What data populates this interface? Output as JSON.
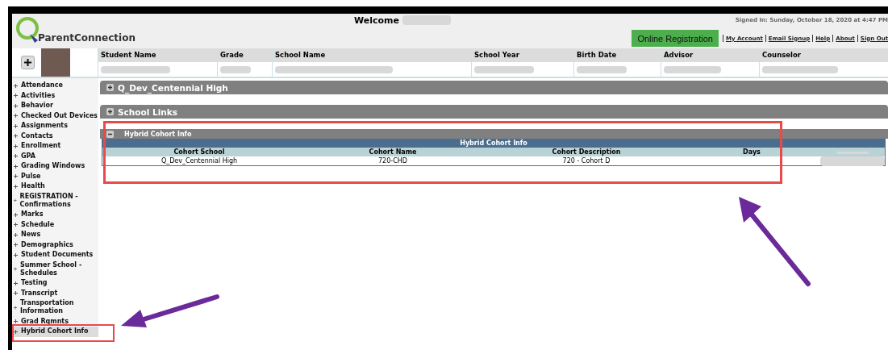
{
  "header": {
    "welcome": "Welcome",
    "signed_in": "Signed In: Sunday, October 18, 2020 at 4:47 PM",
    "logo": "ParentConnection",
    "registration_button": "Online Registration",
    "links": [
      "My Account",
      "Email Signup",
      "Help",
      "About",
      "Sign Out"
    ]
  },
  "student_table": {
    "columns": [
      "Student Name",
      "Grade",
      "School Name",
      "School Year",
      "Birth Date",
      "Advisor",
      "Counselor"
    ]
  },
  "sidebar": {
    "items": [
      {
        "label": "Attendance",
        "selected": false
      },
      {
        "label": "Activities",
        "selected": false
      },
      {
        "label": "Behavior",
        "selected": false
      },
      {
        "label": "Checked Out Devices",
        "selected": false
      },
      {
        "label": "Assignments",
        "selected": false
      },
      {
        "label": "Contacts",
        "selected": false
      },
      {
        "label": "Enrollment",
        "selected": false
      },
      {
        "label": "GPA",
        "selected": false
      },
      {
        "label": "Grading Windows",
        "selected": false
      },
      {
        "label": "Pulse",
        "selected": false
      },
      {
        "label": "Health",
        "selected": false
      },
      {
        "label": "REGISTRATION - Confirmations",
        "selected": false
      },
      {
        "label": "Marks",
        "selected": false
      },
      {
        "label": "Schedule",
        "selected": false
      },
      {
        "label": "News",
        "selected": false
      },
      {
        "label": "Demographics",
        "selected": false
      },
      {
        "label": "Student Documents",
        "selected": false
      },
      {
        "label": "Summer School - Schedules",
        "selected": false
      },
      {
        "label": "Testing",
        "selected": false
      },
      {
        "label": "Transcript",
        "selected": false
      },
      {
        "label": "Transportation Information",
        "selected": false
      },
      {
        "label": "Grad Rqmnts",
        "selected": false
      },
      {
        "label": "Hybrid Cohort Info",
        "selected": true
      }
    ]
  },
  "panels": [
    {
      "title": "Q_Dev_Centennial High",
      "expanded": false
    },
    {
      "title": "School Links",
      "expanded": false
    },
    {
      "title": "Hybrid Cohort Info",
      "expanded": true,
      "table": {
        "caption": "Hybrid Cohort Info",
        "columns": [
          "Cohort School",
          "Cohort Name",
          "Cohort Description",
          "Days"
        ],
        "rows": [
          [
            "Q_Dev_Centennial High",
            "720-CHD",
            "720 - Cohort D"
          ]
        ]
      }
    }
  ]
}
